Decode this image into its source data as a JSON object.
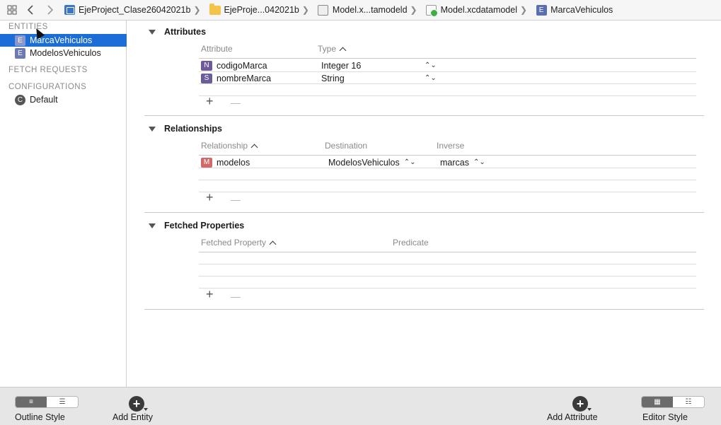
{
  "jumpbar": {
    "crumbs": [
      {
        "label": "EjeProject_Clase26042021b",
        "icon": "project-icon"
      },
      {
        "label": "EjeProje...042021b",
        "icon": "folder-icon"
      },
      {
        "label": "Model.x...tamodeld",
        "icon": "model-icon"
      },
      {
        "label": "Model.xcdatamodel",
        "icon": "xcdatamodel-icon"
      },
      {
        "label": "MarcaVehiculos",
        "icon": "entity-icon"
      }
    ],
    "entity_badge": "E"
  },
  "sidebar": {
    "entities_header": "ENTITIES",
    "entities": [
      {
        "label": "MarcaVehiculos",
        "badge": "E",
        "selected": true
      },
      {
        "label": "ModelosVehiculos",
        "badge": "E",
        "selected": false
      }
    ],
    "fetch_requests_header": "FETCH REQUESTS",
    "configurations_header": "CONFIGURATIONS",
    "configurations": [
      {
        "label": "Default",
        "badge": "C"
      }
    ]
  },
  "attributes": {
    "title": "Attributes",
    "col_attribute": "Attribute",
    "col_type": "Type",
    "rows": [
      {
        "badge": "N",
        "name": "codigoMarca",
        "type": "Integer 16"
      },
      {
        "badge": "S",
        "name": "nombreMarca",
        "type": "String"
      }
    ]
  },
  "relationships": {
    "title": "Relationships",
    "col_relationship": "Relationship",
    "col_destination": "Destination",
    "col_inverse": "Inverse",
    "rows": [
      {
        "badge": "M",
        "name": "modelos",
        "destination": "ModelosVehiculos",
        "inverse": "marcas"
      }
    ]
  },
  "fetched": {
    "title": "Fetched Properties",
    "col_property": "Fetched Property",
    "col_predicate": "Predicate"
  },
  "controls": {
    "plus": "+",
    "stepper": "⌃⌄"
  },
  "bottombar": {
    "outline_style": "Outline Style",
    "add_entity": "Add Entity",
    "add_attribute": "Add Attribute",
    "editor_style": "Editor Style"
  }
}
